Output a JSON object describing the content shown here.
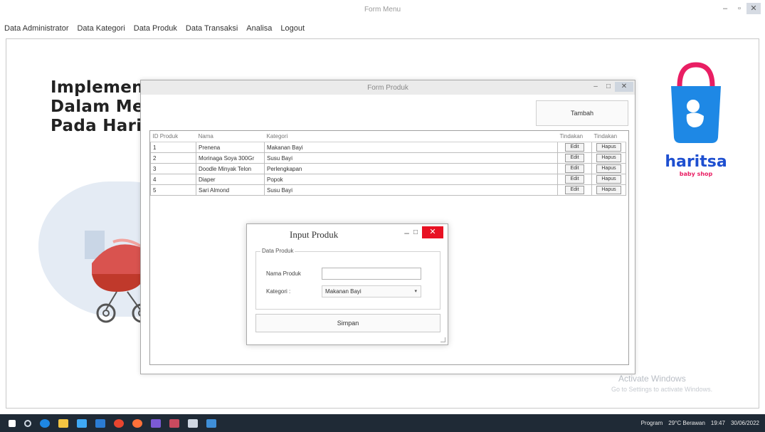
{
  "main_window": {
    "title": "Form Menu",
    "min_label": "–",
    "max_label": "▫",
    "close_label": "✕"
  },
  "menu": [
    {
      "label": "Data Administrator"
    },
    {
      "label": "Data Kategori"
    },
    {
      "label": "Data Produk"
    },
    {
      "label": "Data Transaksi"
    },
    {
      "label": "Analisa"
    },
    {
      "label": "Logout"
    }
  ],
  "headline": {
    "line1": "Implemen",
    "line2": "Dalam Me",
    "line3": "Pada Harit"
  },
  "logo": {
    "brand": "haritsa",
    "tagline": "baby shop",
    "accent_color": "#e91e63",
    "primary_color": "#1e88e5"
  },
  "watermark": {
    "line1": "Activate Windows",
    "line2": "Go to Settings to activate Windows."
  },
  "form_produk": {
    "title": "Form Produk",
    "min_label": "–",
    "max_label": "□",
    "close_label": "✕",
    "tambah_label": "Tambah",
    "columns": [
      "ID Produk",
      "Nama",
      "Kategori",
      "Tindakan",
      "Tindakan"
    ],
    "rows": [
      {
        "id": "1",
        "nama": "Prenena",
        "kategori": "Makanan Bayi",
        "edit": "Edit",
        "hapus": "Hapus"
      },
      {
        "id": "2",
        "nama": "Morinaga Soya 300Gr",
        "kategori": "Susu Bayi",
        "edit": "Edit",
        "hapus": "Hapus"
      },
      {
        "id": "3",
        "nama": "Doodle Minyak Telon",
        "kategori": "Perlengkapan",
        "edit": "Edit",
        "hapus": "Hapus"
      },
      {
        "id": "4",
        "nama": "Diaper",
        "kategori": "Popok",
        "edit": "Edit",
        "hapus": "Hapus"
      },
      {
        "id": "5",
        "nama": "Sari Almond",
        "kategori": "Susu Bayi",
        "edit": "Edit",
        "hapus": "Hapus"
      }
    ]
  },
  "input_produk": {
    "title": "Input Produk",
    "min_label": "–",
    "max_label": "□",
    "close_label": "✕",
    "group_label": "Data Produk",
    "nama_label": "Nama Produk",
    "nama_value": "",
    "kategori_label": "Kategori :",
    "kategori_value": "Makanan Bayi",
    "select_arrow": "▾",
    "simpan_label": "Simpan"
  },
  "taskbar": {
    "app_label": "Program",
    "weather": "29°C  Berawan",
    "time": "19:47",
    "date": "30/06/2022"
  }
}
